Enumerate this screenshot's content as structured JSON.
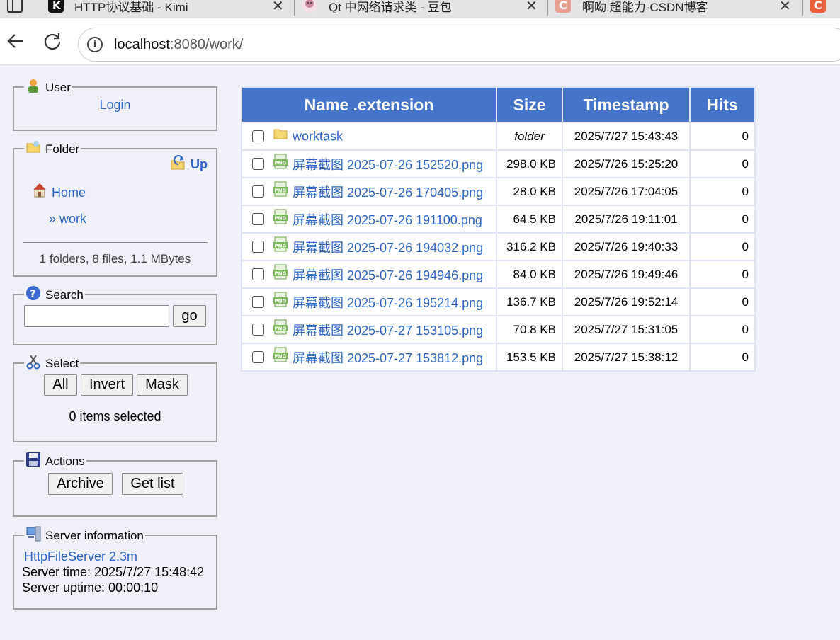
{
  "browser": {
    "tabs": [
      {
        "title": "HTTP协议基础 - Kimi",
        "icon": "kimi-icon",
        "color": "#111111"
      },
      {
        "title": "Qt 中网络请求类 - 豆包",
        "icon": "doubao-icon",
        "color": "#c98aa0"
      },
      {
        "title": "啊呦.超能力-CSDN博客",
        "icon": "csdn-icon",
        "color": "#e8a090"
      }
    ],
    "url_host": "localhost",
    "url_path": ":8080/work/"
  },
  "user_panel": {
    "legend": "User",
    "login": "Login"
  },
  "folder_panel": {
    "legend": "Folder",
    "up": "Up",
    "home": "Home",
    "current": "» work",
    "summary": "1 folders, 8 files, 1.1 MBytes"
  },
  "search_panel": {
    "legend": "Search",
    "go": "go",
    "value": ""
  },
  "select_panel": {
    "legend": "Select",
    "all": "All",
    "invert": "Invert",
    "mask": "Mask",
    "status": "0 items selected"
  },
  "actions_panel": {
    "legend": "Actions",
    "archive": "Archive",
    "get_list": "Get list"
  },
  "server_panel": {
    "legend": "Server information",
    "software": "HttpFileServer 2.3m",
    "time": "Server time: 2025/7/27 15:48:42",
    "uptime": "Server uptime: 00:00:10"
  },
  "table": {
    "headers": {
      "name": "Name .extension",
      "size": "Size",
      "timestamp": "Timestamp",
      "hits": "Hits"
    },
    "rows": [
      {
        "name": "worktask",
        "size": "folder",
        "timestamp": "2025/7/27 15:43:43",
        "hits": "0",
        "type": "folder"
      },
      {
        "name": "屏幕截图 2025-07-26 152520.png",
        "size": "298.0 KB",
        "timestamp": "2025/7/26 15:25:20",
        "hits": "0",
        "type": "png"
      },
      {
        "name": "屏幕截图 2025-07-26 170405.png",
        "size": "28.0 KB",
        "timestamp": "2025/7/26 17:04:05",
        "hits": "0",
        "type": "png"
      },
      {
        "name": "屏幕截图 2025-07-26 191100.png",
        "size": "64.5 KB",
        "timestamp": "2025/7/26 19:11:01",
        "hits": "0",
        "type": "png"
      },
      {
        "name": "屏幕截图 2025-07-26 194032.png",
        "size": "316.2 KB",
        "timestamp": "2025/7/26 19:40:33",
        "hits": "0",
        "type": "png"
      },
      {
        "name": "屏幕截图 2025-07-26 194946.png",
        "size": "84.0 KB",
        "timestamp": "2025/7/26 19:49:46",
        "hits": "0",
        "type": "png"
      },
      {
        "name": "屏幕截图 2025-07-26 195214.png",
        "size": "136.7 KB",
        "timestamp": "2025/7/26 19:52:14",
        "hits": "0",
        "type": "png"
      },
      {
        "name": "屏幕截图 2025-07-27 153105.png",
        "size": "70.8 KB",
        "timestamp": "2025/7/27 15:31:05",
        "hits": "0",
        "type": "png"
      },
      {
        "name": "屏幕截图 2025-07-27 153812.png",
        "size": "153.5 KB",
        "timestamp": "2025/7/27 15:38:12",
        "hits": "0",
        "type": "png"
      }
    ]
  },
  "colors": {
    "page_bg": "#f0f0f8",
    "header_bg": "#4574c8",
    "link": "#2c64c0"
  }
}
